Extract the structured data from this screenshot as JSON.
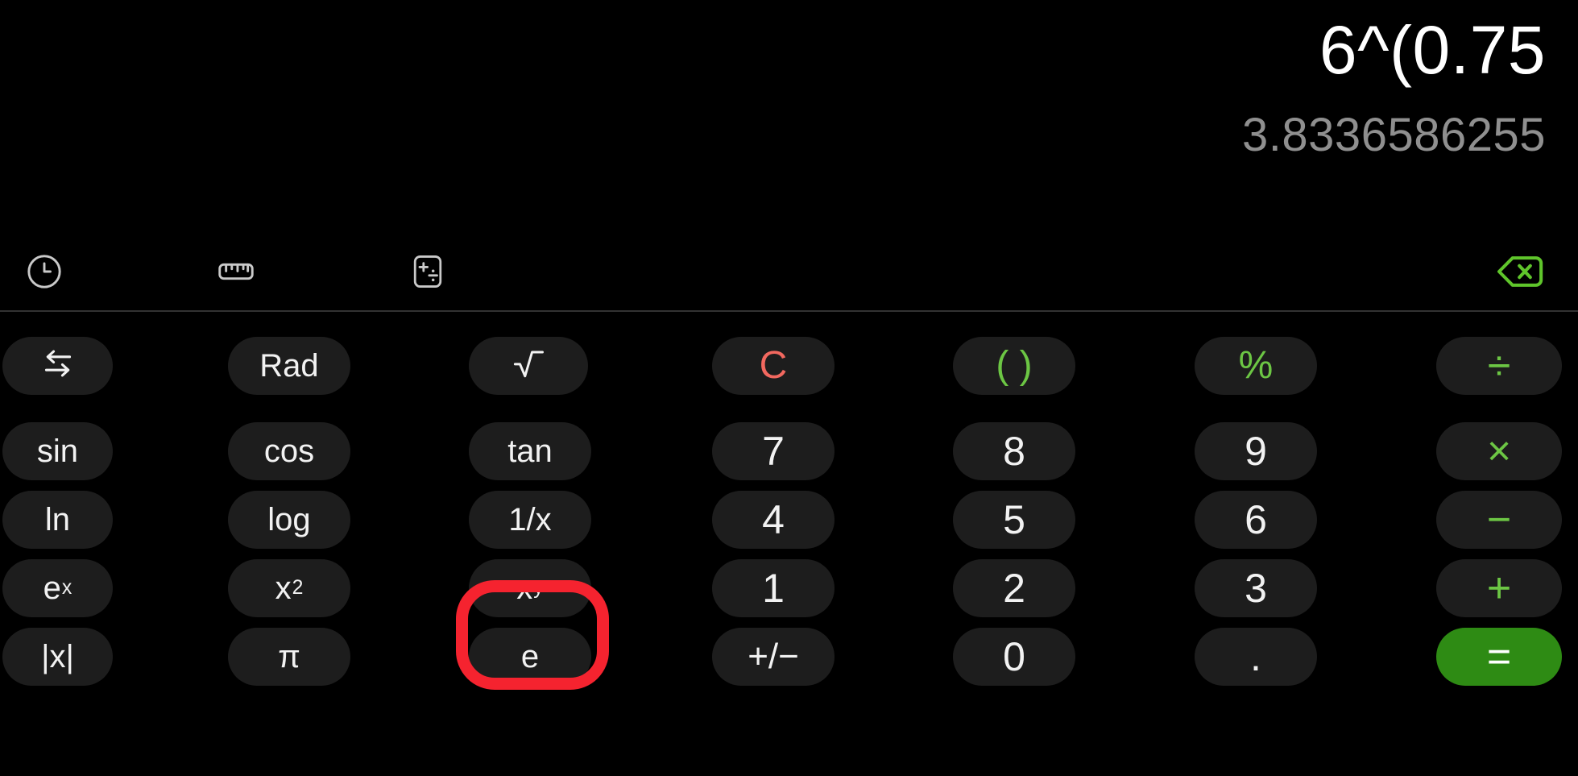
{
  "app": {
    "name": "Calculator",
    "theme": "dark"
  },
  "display": {
    "expression": "6^(0.75",
    "result": "3.8336586255"
  },
  "toolbar": {
    "items": [
      {
        "id": "history",
        "icon": "clock-icon",
        "label": "History"
      },
      {
        "id": "converter",
        "icon": "ruler-icon",
        "label": "Unit converter"
      },
      {
        "id": "calculator",
        "icon": "calculator-icon",
        "label": "Calculator"
      },
      {
        "id": "backspace",
        "icon": "backspace-icon",
        "label": "Backspace"
      }
    ]
  },
  "colors": {
    "background": "#000000",
    "key_background": "#1d1d1d",
    "text": "#f2f2f2",
    "result_text": "#8f8f8f",
    "operator_green": "#6CC644",
    "equals_green": "#2E8B14",
    "clear_red": "#F2685F",
    "highlight_ring": "#F5232F",
    "divider": "#323232"
  },
  "keypad": {
    "rows": [
      [
        {
          "id": "swap",
          "label": "",
          "type": "icon-swap"
        },
        {
          "id": "rad",
          "label": "Rad",
          "type": "func"
        },
        {
          "id": "sqrt",
          "label": "",
          "type": "icon-sqrt"
        },
        {
          "id": "clear",
          "label": "C",
          "type": "clear"
        },
        {
          "id": "paren",
          "label": "( )",
          "type": "paren"
        },
        {
          "id": "percent",
          "label": "%",
          "type": "pct"
        },
        {
          "id": "divide",
          "label": "÷",
          "type": "op"
        }
      ],
      [
        {
          "id": "sin",
          "label": "sin",
          "type": "func"
        },
        {
          "id": "cos",
          "label": "cos",
          "type": "func"
        },
        {
          "id": "tan",
          "label": "tan",
          "type": "func"
        },
        {
          "id": "seven",
          "label": "7",
          "type": "digit"
        },
        {
          "id": "eight",
          "label": "8",
          "type": "digit"
        },
        {
          "id": "nine",
          "label": "9",
          "type": "digit"
        },
        {
          "id": "multiply",
          "label": "×",
          "type": "op"
        }
      ],
      [
        {
          "id": "ln",
          "label": "ln",
          "type": "func"
        },
        {
          "id": "log",
          "label": "log",
          "type": "func"
        },
        {
          "id": "reciprocal",
          "label": "1/x",
          "type": "func"
        },
        {
          "id": "four",
          "label": "4",
          "type": "digit"
        },
        {
          "id": "five",
          "label": "5",
          "type": "digit"
        },
        {
          "id": "six",
          "label": "6",
          "type": "digit"
        },
        {
          "id": "minus",
          "label": "−",
          "type": "op"
        }
      ],
      [
        {
          "id": "e-pow-x",
          "label": "e",
          "sup": "x",
          "type": "func-sup"
        },
        {
          "id": "x-squared",
          "label": "x",
          "sup": "2",
          "type": "func-sup"
        },
        {
          "id": "x-pow-y",
          "label": "x",
          "sup": "y",
          "type": "func-sup",
          "highlighted": true
        },
        {
          "id": "one",
          "label": "1",
          "type": "digit"
        },
        {
          "id": "two",
          "label": "2",
          "type": "digit"
        },
        {
          "id": "three",
          "label": "3",
          "type": "digit"
        },
        {
          "id": "plus",
          "label": "+",
          "type": "op"
        }
      ],
      [
        {
          "id": "abs",
          "label": "|x|",
          "type": "func"
        },
        {
          "id": "pi",
          "label": "π",
          "type": "func"
        },
        {
          "id": "euler",
          "label": "e",
          "type": "func"
        },
        {
          "id": "sign",
          "label": "+/−",
          "type": "digit-small"
        },
        {
          "id": "zero",
          "label": "0",
          "type": "digit"
        },
        {
          "id": "decimal",
          "label": ".",
          "type": "digit"
        },
        {
          "id": "equals",
          "label": "=",
          "type": "equals"
        }
      ]
    ]
  }
}
